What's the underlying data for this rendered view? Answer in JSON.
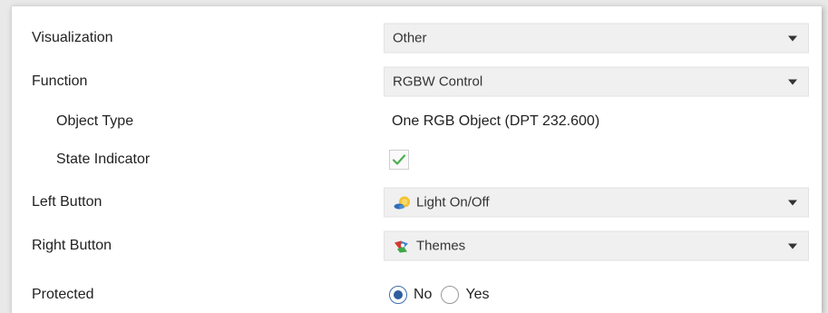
{
  "colors": {
    "accent": "#2e5e9f",
    "check": "#4caf50",
    "dropdown_bg": "#f0f0f0"
  },
  "rows": [
    {
      "label": "Visualization",
      "value": "Other"
    },
    {
      "label": "Function",
      "value": "RGBW Control"
    },
    {
      "label": "Object Type",
      "value": "One RGB Object (DPT 232.600)"
    },
    {
      "label": "State Indicator",
      "checked": true
    },
    {
      "label": "Left Button",
      "value": "Light On/Off",
      "icon": "light-bulb-icon"
    },
    {
      "label": "Right Button",
      "value": "Themes",
      "icon": "themes-icon"
    },
    {
      "label": "Protected",
      "options": [
        {
          "label": "No",
          "selected": true
        },
        {
          "label": "Yes",
          "selected": false
        }
      ]
    }
  ]
}
